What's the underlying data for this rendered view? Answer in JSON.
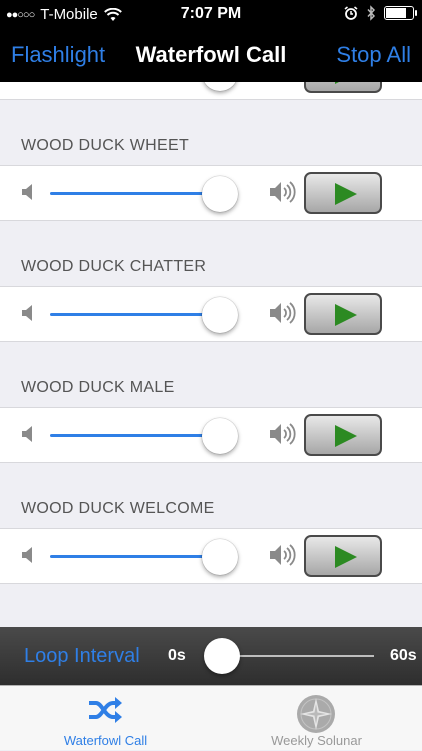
{
  "status_bar": {
    "carrier": "T-Mobile",
    "time": "7:07 PM",
    "signal_dots": "●●○○○",
    "icons": [
      "wifi-icon",
      "alarm-icon",
      "bluetooth-icon",
      "battery-icon"
    ],
    "battery_level": 0.85
  },
  "nav_bar": {
    "left_label": "Flashlight",
    "title": "Waterfowl Call",
    "right_label": "Stop All"
  },
  "sounds": [
    {
      "name": "",
      "volume": 0.92
    },
    {
      "name": "WOOD DUCK WHEET",
      "volume": 0.92
    },
    {
      "name": "WOOD DUCK CHATTER",
      "volume": 0.92
    },
    {
      "name": "WOOD DUCK MALE",
      "volume": 0.92
    },
    {
      "name": "WOOD DUCK WELCOME",
      "volume": 0.92
    }
  ],
  "loop_interval": {
    "label": "Loop Interval",
    "min_label": "0s",
    "max_label": "60s",
    "value": 0
  },
  "tab_bar": {
    "tabs": [
      {
        "label": "Waterfowl Call",
        "icon": "shuffle-icon",
        "active": true
      },
      {
        "label": "Weekly Solunar",
        "icon": "compass-icon",
        "active": false
      }
    ]
  },
  "colors": {
    "accent": "#2f7fe6",
    "play": "#2c8a22",
    "nav_background": "#000000"
  }
}
